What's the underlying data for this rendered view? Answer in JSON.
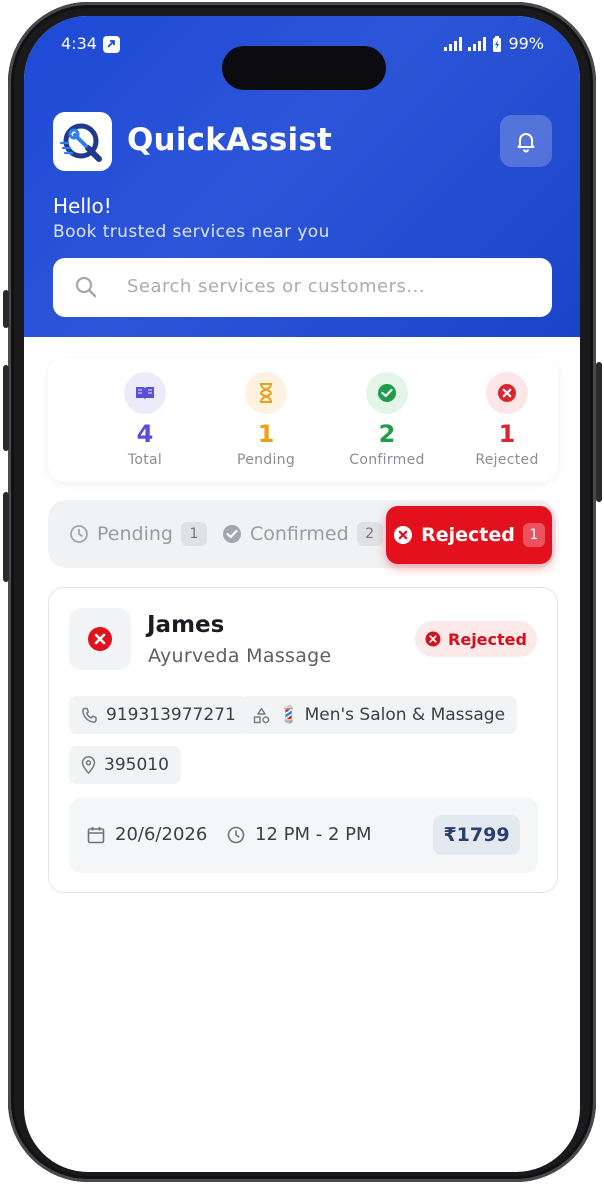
{
  "status_bar": {
    "time": "4:34",
    "battery": "99%"
  },
  "app": {
    "title": "QuickAssist"
  },
  "header": {
    "greeting": "Hello!",
    "subtitle": "Book trusted services near you"
  },
  "search": {
    "placeholder": "Search services or customers..."
  },
  "stats": [
    {
      "value": "4",
      "label": "Total",
      "color": "#5a4fd6",
      "bg": "#ecebfb",
      "icon": "book-icon"
    },
    {
      "value": "1",
      "label": "Pending",
      "color": "#e8a21a",
      "bg": "#fdf2e0",
      "icon": "hourglass-icon"
    },
    {
      "value": "2",
      "label": "Confirmed",
      "color": "#1f9d4a",
      "bg": "#e3f5e9",
      "icon": "check-circle-icon"
    },
    {
      "value": "1",
      "label": "Rejected",
      "color": "#d9262f",
      "bg": "#fde6e8",
      "icon": "x-circle-icon"
    }
  ],
  "tabs": [
    {
      "label": "Pending",
      "count": "1",
      "icon": "clock-icon"
    },
    {
      "label": "Confirmed",
      "count": "2",
      "icon": "check-circle-icon"
    },
    {
      "label": "Rejected",
      "count": "1",
      "icon": "x-circle-icon",
      "active": true
    }
  ],
  "booking": {
    "customer_name": "James",
    "service": "Ayurveda Massage",
    "status": "Rejected",
    "phone": "919313977271",
    "category": "💈 Men's Salon & Massage",
    "pincode": "395010",
    "date": "20/6/2026",
    "time_slot": "12 PM - 2 PM",
    "price": "₹1799"
  },
  "colors": {
    "primary": "#1d49d6",
    "danger": "#e2111d"
  }
}
